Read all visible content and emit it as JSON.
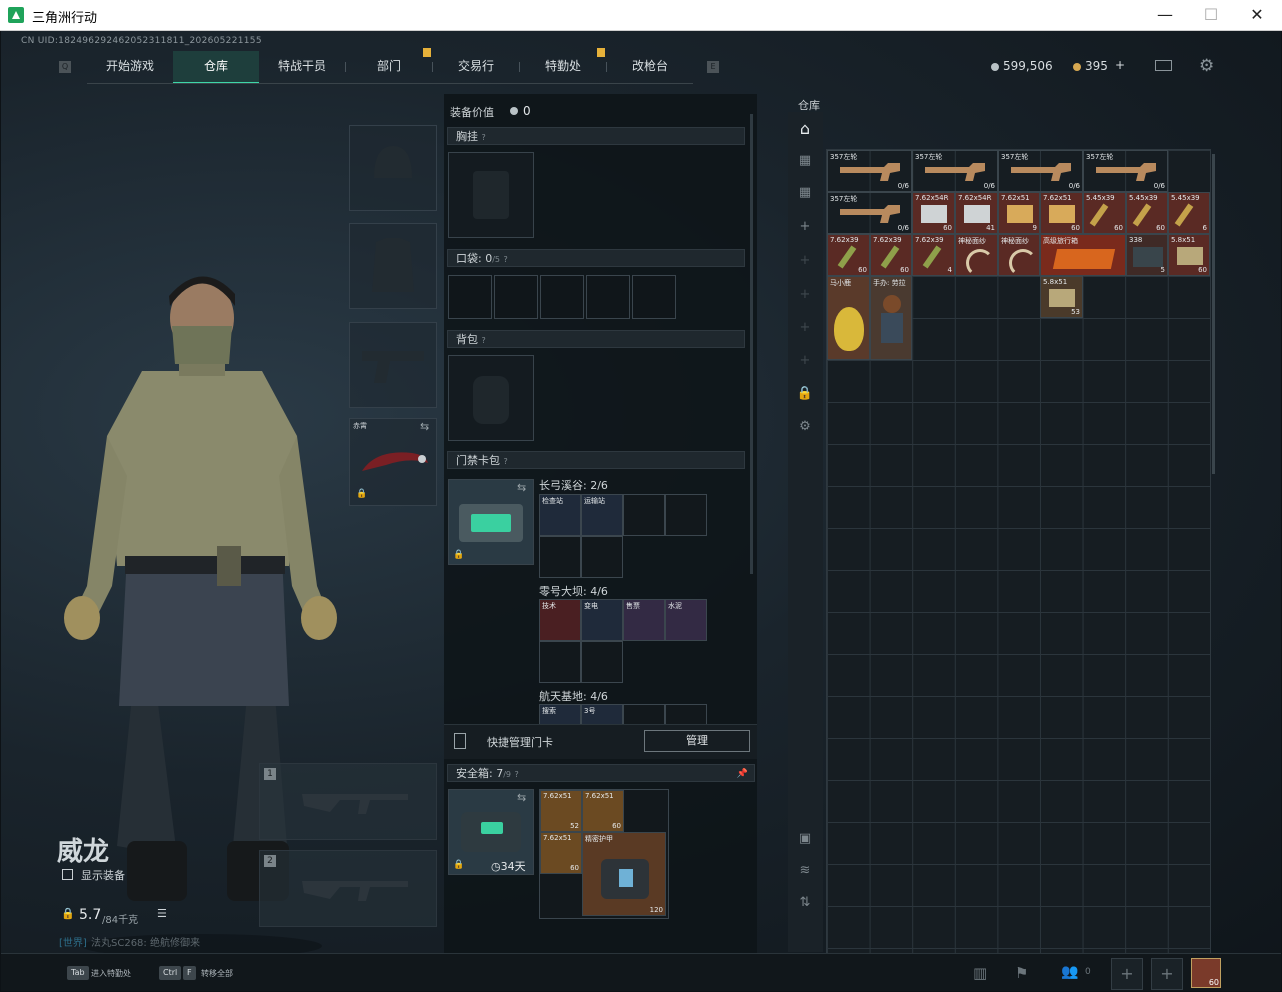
{
  "window": {
    "title": "三角洲行动",
    "minimize": "—",
    "maximize": "☐",
    "close": "✕"
  },
  "uid": "CN UID:182496292462052311811_202605221155",
  "nav": {
    "tabs": [
      "开始游戏",
      "仓库",
      "特战干员",
      "部门",
      "交易行",
      "特勤处",
      "改枪台"
    ],
    "active": "仓库",
    "left_key": "Q",
    "right_key": "E"
  },
  "currency": {
    "silver": "599,506",
    "gold": "395",
    "gold_plus": "+"
  },
  "character": {
    "name": "威龙",
    "show_equipment": "显示装备",
    "weight": "5.7",
    "weight_max": "/84千克",
    "chat_channel": "[世界]",
    "chat_text": "法丸SC268: 绝航修御来"
  },
  "equip_slots": {
    "knife_label": "赤霄"
  },
  "weapons": [
    {
      "num": "1"
    },
    {
      "num": "2"
    }
  ],
  "middle": {
    "gear_value_label": "装备价值",
    "gear_value": "0",
    "chest_label": "胸挂",
    "pocket_label": "口袋:",
    "pocket_count": "0",
    "pocket_max": "/5",
    "backpack_label": "背包",
    "keycard_label": "门禁卡包",
    "key_groups": [
      {
        "name": "长弓溪谷: 2/6",
        "cards": [
          "检查站",
          "运输站"
        ]
      },
      {
        "name": "零号大坝: 4/6",
        "cards": [
          "技术",
          "变电",
          "售票",
          "水泥"
        ]
      },
      {
        "name": "航天基地: 4/6",
        "cards": [
          "搜索",
          "3号"
        ]
      }
    ],
    "quick_manage": "快捷管理门卡",
    "manage_btn": "管理",
    "safe_label": "安全箱:",
    "safe_count": "7",
    "safe_max": "/9",
    "safe_days": "34天",
    "safe_items": [
      {
        "label": "7.62x51",
        "count": "52"
      },
      {
        "label": "7.62x51",
        "count": "60"
      },
      {
        "label": "7.62x51",
        "count": "60"
      },
      {
        "label": "精密护甲",
        "count": "120"
      }
    ]
  },
  "warehouse": {
    "title": "仓库",
    "items": [
      {
        "label": "357左轮",
        "count": "0/6"
      },
      {
        "label": "357左轮",
        "count": "0/6"
      },
      {
        "label": "357左轮",
        "count": "0/6"
      },
      {
        "label": "357左轮",
        "count": "0/6"
      },
      {
        "label": "357左轮",
        "count": "0/6"
      },
      {
        "label": "7.62x54R",
        "count": "60"
      },
      {
        "label": "7.62x54R",
        "count": "41"
      },
      {
        "label": "7.62x51",
        "count": "9"
      },
      {
        "label": "7.62x51",
        "count": "60"
      },
      {
        "label": "5.45x39",
        "count": "60"
      },
      {
        "label": "5.45x39",
        "count": "60"
      },
      {
        "label": "5.45x39",
        "count": "6"
      },
      {
        "label": "7.62x39",
        "count": "60"
      },
      {
        "label": "7.62x39",
        "count": "60"
      },
      {
        "label": "7.62x39",
        "count": "4"
      },
      {
        "label": "神秘面纱",
        "count": ""
      },
      {
        "label": "神秘面纱",
        "count": ""
      },
      {
        "label": "高级旅行箱",
        "count": ""
      },
      {
        "label": "338",
        "count": "5"
      },
      {
        "label": "5.8x51",
        "count": "60"
      },
      {
        "label": "马小鹿",
        "count": ""
      },
      {
        "label": "手办: 劳拉",
        "count": ""
      },
      {
        "label": "5.8x51",
        "count": "53"
      }
    ]
  },
  "bottom": {
    "tab_key": "Tab",
    "tab_label": "进入特勤处",
    "ctrl_key": "Ctrl",
    "f_key": "F",
    "ctrl_label": "转移全部",
    "friends": "0",
    "level": "60"
  },
  "colors": {
    "accent": "#3ed6a8",
    "gold": "#d7a851",
    "red_item": "#5a2a24",
    "gold_item": "#6b4a22"
  }
}
